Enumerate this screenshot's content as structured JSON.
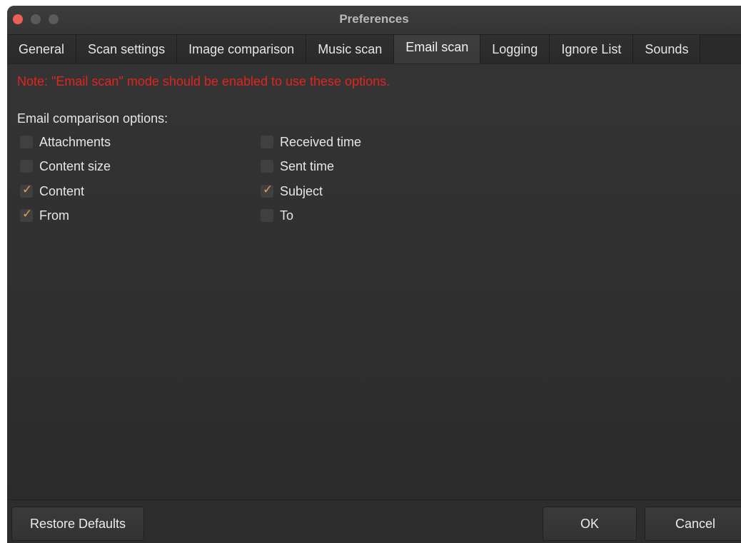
{
  "window": {
    "title": "Preferences"
  },
  "tabs": [
    {
      "label": "General"
    },
    {
      "label": "Scan settings"
    },
    {
      "label": "Image comparison"
    },
    {
      "label": "Music scan"
    },
    {
      "label": "Email scan",
      "active": true
    },
    {
      "label": "Logging"
    },
    {
      "label": "Ignore List"
    },
    {
      "label": "Sounds"
    }
  ],
  "email_scan": {
    "note": "Note: \"Email scan\" mode should be enabled to use these options.",
    "group_label": "Email comparison options:",
    "options": {
      "attachments": {
        "label": "Attachments",
        "checked": false
      },
      "content_size": {
        "label": "Content size",
        "checked": false
      },
      "content": {
        "label": "Content",
        "checked": true
      },
      "from": {
        "label": "From",
        "checked": true
      },
      "received_time": {
        "label": "Received time",
        "checked": false
      },
      "sent_time": {
        "label": "Sent time",
        "checked": false
      },
      "subject": {
        "label": "Subject",
        "checked": true
      },
      "to": {
        "label": "To",
        "checked": false
      }
    }
  },
  "footer": {
    "restore_label": "Restore Defaults",
    "ok_label": "OK",
    "cancel_label": "Cancel"
  },
  "colors": {
    "note_red": "#e0251f",
    "check_orange": "#d9a34a",
    "close_button": "#ec5f57"
  }
}
